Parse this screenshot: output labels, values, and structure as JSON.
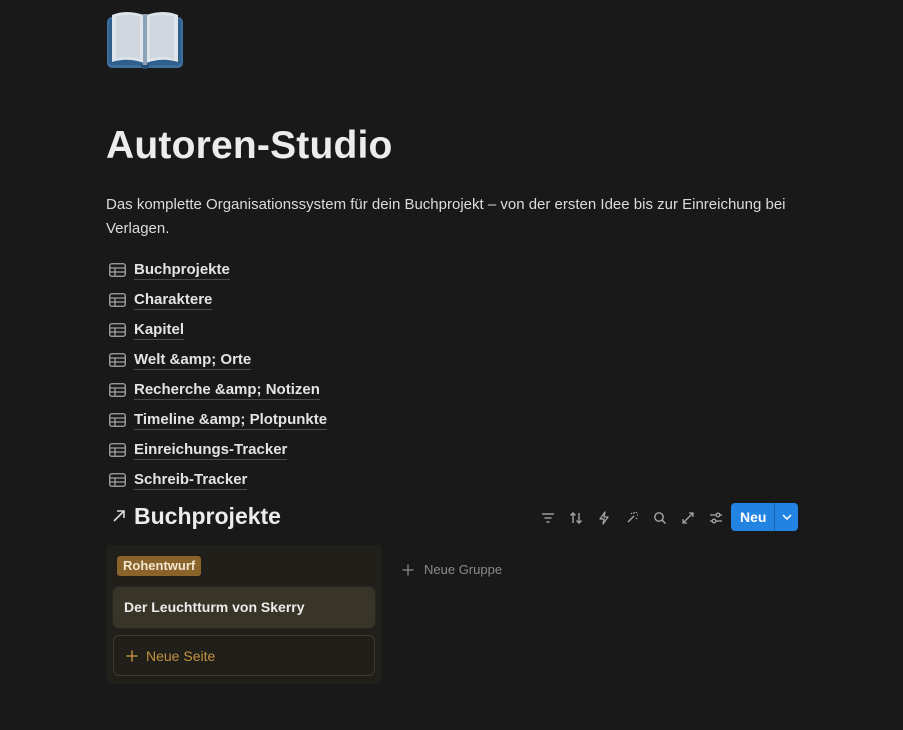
{
  "page": {
    "icon": "open-book-icon",
    "title": "Autoren-Studio",
    "description": "Das komplette Organisationssystem für dein Buchprojekt – von der ersten Idee bis zur Einreichung bei Verlagen."
  },
  "databases": [
    {
      "label": "Buchprojekte",
      "icon": "table-icon"
    },
    {
      "label": "Charaktere",
      "icon": "table-icon"
    },
    {
      "label": "Kapitel",
      "icon": "table-icon"
    },
    {
      "label": "Welt &amp; Orte",
      "icon": "table-icon"
    },
    {
      "label": "Recherche &amp; Notizen",
      "icon": "table-icon"
    },
    {
      "label": "Timeline &amp; Plotpunkte",
      "icon": "table-icon"
    },
    {
      "label": "Einreichungs-Tracker",
      "icon": "table-icon"
    },
    {
      "label": "Schreib-Tracker",
      "icon": "table-icon"
    }
  ],
  "board": {
    "title": "Buchprojekte",
    "toolbar_icons": [
      "filter-icon",
      "sort-icon",
      "automation-icon",
      "magic-icon",
      "search-icon",
      "expand-icon",
      "settings-icon"
    ],
    "new_button": "Neu",
    "groups": [
      {
        "tag": "Rohentwurf",
        "tag_color": "#89632a",
        "cards": [
          {
            "title": "Der Leuchtturm von Skerry"
          }
        ],
        "new_page_label": "Neue Seite"
      }
    ],
    "new_group_label": "Neue Gruppe"
  },
  "colors": {
    "background": "#191919",
    "accent": "#2383e2",
    "column_bg": "#211f1a",
    "card_bg": "#383428",
    "tag_bg": "#89632a",
    "new_page_text": "#c4933f"
  }
}
